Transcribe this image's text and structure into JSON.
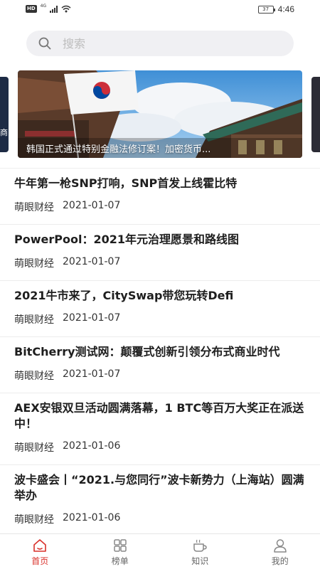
{
  "status_bar": {
    "hd": "HD",
    "network": "4G",
    "battery": "37",
    "time": "4:46"
  },
  "search": {
    "placeholder": "搜索"
  },
  "banner": {
    "caption": "韩国正式通过特别金融法修订案！加密货币...",
    "left_peek_text": "商"
  },
  "news": [
    {
      "title": "牛年第一枪SNP打响，SNP首发上线霍比特",
      "source": "萌眼财经",
      "date": "2021-01-07"
    },
    {
      "title": "PowerPool：2021年元治理愿景和路线图",
      "source": "萌眼财经",
      "date": "2021-01-07"
    },
    {
      "title": "2021牛市来了，CitySwap带您玩转Defi",
      "source": "萌眼财经",
      "date": "2021-01-07"
    },
    {
      "title": "BitCherry测试网：颠覆式创新引领分布式商业时代",
      "source": "萌眼财经",
      "date": "2021-01-07"
    },
    {
      "title": "AEX安银双旦活动圆满落幕，1 BTC等百万大奖正在派送中！",
      "source": "萌眼财经",
      "date": "2021-01-06"
    },
    {
      "title": "波卡盛会丨“2021.与您同行”波卡新势力（上海站）圆满举办",
      "source": "萌眼财经",
      "date": "2021-01-06"
    }
  ],
  "tabs": [
    {
      "label": "首页",
      "icon": "home-icon",
      "active": true
    },
    {
      "label": "榜单",
      "icon": "grid-icon",
      "active": false
    },
    {
      "label": "知识",
      "icon": "coffee-icon",
      "active": false
    },
    {
      "label": "我的",
      "icon": "user-icon",
      "active": false
    }
  ],
  "colors": {
    "accent": "#d9302a",
    "search_bg": "#f0f0f3"
  }
}
